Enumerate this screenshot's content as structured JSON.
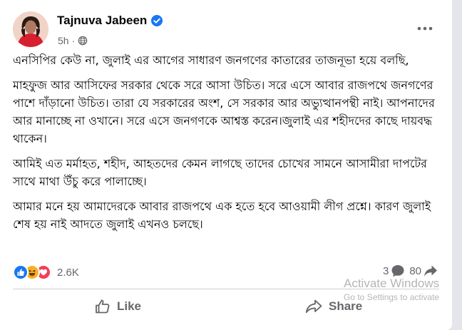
{
  "post": {
    "author": "Tajnuva Jabeen",
    "time": "5h",
    "paragraphs": [
      "এনসিপির কেউ না, জুলাই এর আগের সাধারণ জনগণের কাতারের তাজনূভা হয়ে বলছি,",
      "মাহফুজ আর আসিফের সরকার থেকে সরে আসা উচিত। সরে এসে আবার রাজপথে জনগণের পাশে দাঁড়ানো উচিত। তারা যে সরকারের অংশ, সে সরকার আর অভ্যুত্থানপন্থী নাই। আপনাদের আর মানাচ্ছে না ওখানে। সরে এসে জনগণকে আশ্বস্ত করেন।জুলাই এর শহীদদের কাছে দায়বদ্ধ থাকেন।",
      "আমিই এত মর্মাহত, শহীদ, আহতদের কেমন লাগছে তাদের চোখের সামনে আসামীরা দাপটের সাথে মাথা উঁচু করে পালাচ্ছে।",
      "আমার মনে হয় আমাদেরকে আবার রাজপথে এক হতে হবে আওয়ামী লীগ প্রশ্নে। কারণ জুলাই শেষ হয় নাই আদতে জুলাই এখনও চলছে।"
    ],
    "reaction_count": "2.6K",
    "comment_count": "3",
    "share_count": "80",
    "icons": {
      "verified": "verified-badge-icon",
      "privacy": "globe-icon",
      "more": "more-options-icon",
      "reactions": [
        "like-reaction-icon",
        "haha-reaction-icon",
        "love-reaction-icon"
      ],
      "comment": "comment-icon",
      "share_count": "share-icon",
      "like_action": "thumbs-up-icon",
      "share_action": "share-arrow-icon"
    },
    "colors": {
      "verified": "#1877f2",
      "like": "#1877f2",
      "haha": "#f7b125",
      "love": "#f33e58"
    }
  },
  "actions": {
    "like": "Like",
    "share": "Share"
  },
  "watermark": {
    "title": "Activate Windows",
    "subtitle": "Go to Settings to activate"
  }
}
